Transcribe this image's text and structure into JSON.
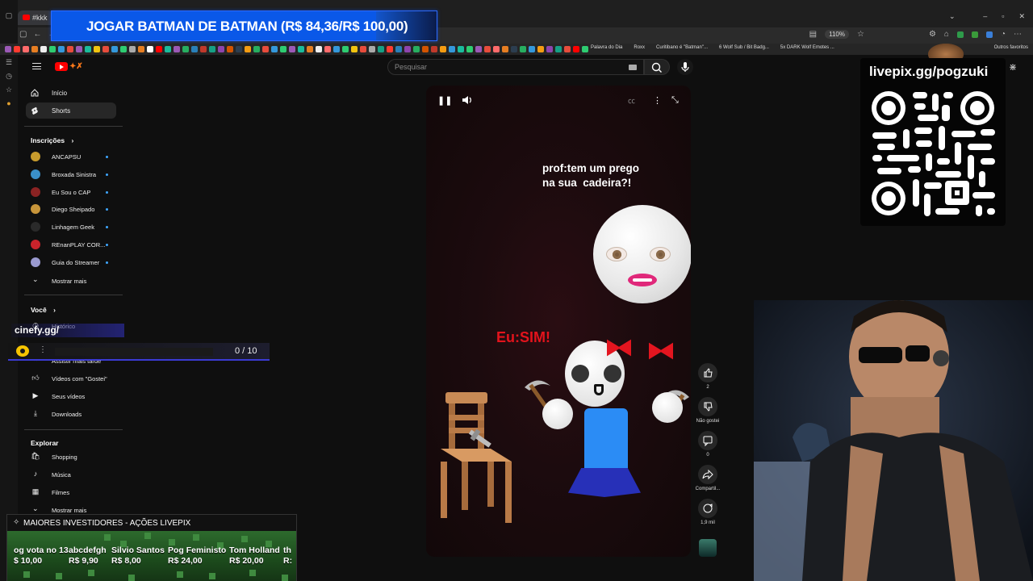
{
  "browser": {
    "tab_label": "#kkk",
    "bookmarks": [
      "Palavra do Dia",
      "Roxx",
      "Curitibano é \"Batman\"...",
      "6 Wolf Sub / Bit Badg...",
      "5x DARK Wolf Emotes ..."
    ],
    "other_bookmarks": "Outros favoritos",
    "zoom": "110%"
  },
  "banner": {
    "text": "JOGAR BATMAN DE BATMAN (R$ 84,36/R$ 100,00)",
    "progress": 0.8436
  },
  "youtube": {
    "search_placeholder": "Pesquisar",
    "nav": [
      {
        "label": "Início",
        "icon": "home-icon"
      },
      {
        "label": "Shorts",
        "icon": "shorts-icon",
        "active": true
      }
    ],
    "subscriptions_title": "Inscrições",
    "subscriptions": [
      {
        "name": "ANCAPSU",
        "color": "#c79b2d"
      },
      {
        "name": "Broxada Sinistra",
        "color": "#3a8fc9"
      },
      {
        "name": "Eu Sou o CAP",
        "color": "#8b2323"
      },
      {
        "name": "Diego Sheipado",
        "color": "#c7953a"
      },
      {
        "name": "Linhagem Geek",
        "color": "#2a2a2a"
      },
      {
        "name": "REnanPLAY COR...",
        "color": "#c9232b"
      },
      {
        "name": "Guia do Streamer",
        "color": "#9a9ad0"
      }
    ],
    "show_more": "Mostrar mais",
    "you_title": "Você",
    "you_items": [
      {
        "label": "Histórico",
        "icon": "history-icon"
      },
      {
        "label": "Assistir mais tarde",
        "icon": "watch-later-icon"
      },
      {
        "label": "Vídeos com \"Gostei\"",
        "icon": "like-icon"
      },
      {
        "label": "Seus vídeos",
        "icon": "your-videos-icon"
      },
      {
        "label": "Downloads",
        "icon": "download-icon"
      }
    ],
    "explore_title": "Explorar",
    "explore_items": [
      {
        "label": "Shopping",
        "icon": "shopping-icon"
      },
      {
        "label": "Música",
        "icon": "music-icon"
      },
      {
        "label": "Filmes",
        "icon": "film-icon"
      }
    ],
    "explore_more": "Mostrar mais"
  },
  "short": {
    "caption": "prof:tem um prego\nna sua  cadeira?!",
    "reaction": "Eu:SIM!",
    "likes": "2",
    "dislike_label": "Não gostei",
    "comments": "0",
    "share_label": "Compartil...",
    "remix_count": "1,9 mil"
  },
  "overlays": {
    "qr_url": "livepix.gg/pogzuki",
    "cinefy_url": "cinefy.gg/",
    "cinefy_count": "0  /  10",
    "investors_title": "MAIORES INVESTIDORES - AÇÕES LIVEPIX",
    "investors": [
      {
        "name": "og vota no 13",
        "value": "$ 10,00"
      },
      {
        "name": "abcdefgh",
        "value": "R$ 9,90"
      },
      {
        "name": "Silvio Santos",
        "value": "R$ 8,00"
      },
      {
        "name": "Pog Feministo",
        "value": "R$ 24,00"
      },
      {
        "name": "Tom Holland",
        "value": "R$ 20,00"
      },
      {
        "name": "th",
        "value": "R:"
      }
    ]
  },
  "colors": {
    "accent_red": "#ff0000",
    "banner_blue": "#0a58e8",
    "reaction_red": "#e3131c"
  }
}
